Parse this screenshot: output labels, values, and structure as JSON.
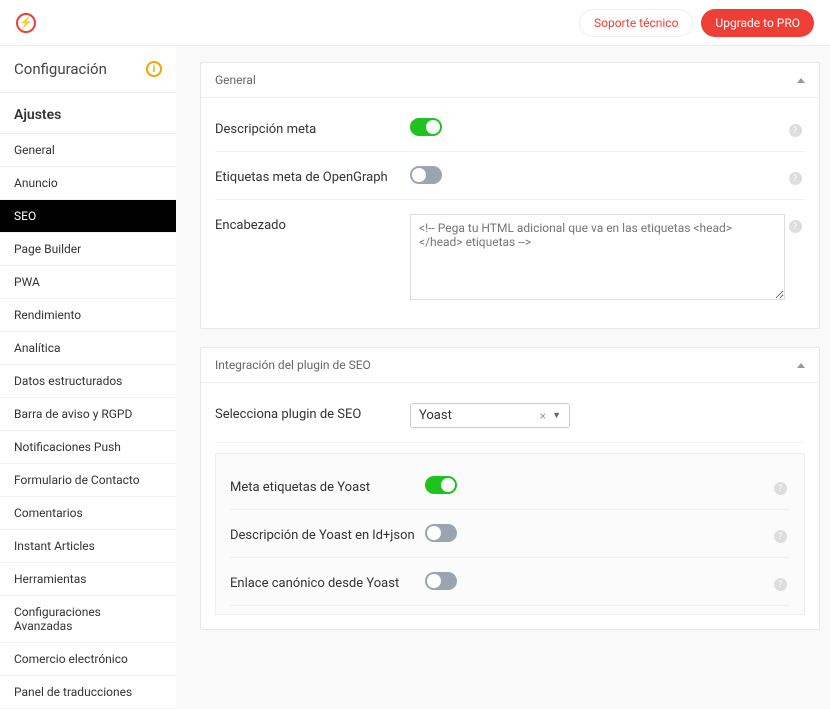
{
  "topbar": {
    "support": "Soporte técnico",
    "upgrade": "Upgrade to PRO"
  },
  "sidebar": {
    "title": "Configuración",
    "subtitle": "Ajustes",
    "items": [
      {
        "label": "General"
      },
      {
        "label": "Anuncio"
      },
      {
        "label": "SEO",
        "active": true
      },
      {
        "label": "Page Builder"
      },
      {
        "label": "PWA"
      },
      {
        "label": "Rendimiento"
      },
      {
        "label": "Analítica"
      },
      {
        "label": "Datos estructurados"
      },
      {
        "label": "Barra de aviso y RGPD"
      },
      {
        "label": "Notificaciones Push"
      },
      {
        "label": "Formulario de Contacto"
      },
      {
        "label": "Comentarios"
      },
      {
        "label": "Instant Articles"
      },
      {
        "label": "Herramientas"
      },
      {
        "label": "Configuraciones Avanzadas"
      },
      {
        "label": "Comercio electrónico"
      },
      {
        "label": "Panel de traducciones"
      }
    ]
  },
  "cards": {
    "general": {
      "title": "General",
      "meta_desc": {
        "label": "Descripción meta",
        "on": true
      },
      "og_tags": {
        "label": "Etiquetas meta de OpenGraph",
        "on": false
      },
      "head": {
        "label": "Encabezado",
        "placeholder": "<!-- Pega tu HTML adicional que va en las etiquetas <head> </head> etiquetas -->"
      }
    },
    "seo_plugin": {
      "title": "Integración del plugin de SEO",
      "select": {
        "label": "Selecciona plugin de SEO",
        "value": "Yoast"
      },
      "yoast_meta": {
        "label": "Meta etiquetas de Yoast",
        "on": true
      },
      "yoast_desc": {
        "label": "Descripción de Yoast en ld+json",
        "on": false
      },
      "yoast_canon": {
        "label": "Enlace canónico desde Yoast",
        "on": false
      }
    }
  }
}
